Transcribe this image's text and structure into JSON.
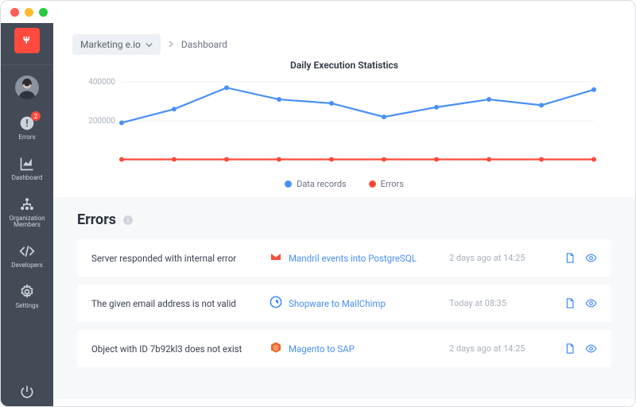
{
  "breadcrumb": {
    "project": "Marketing e.io",
    "current": "Dashboard"
  },
  "sidebar": {
    "errors_badge": "2",
    "items": [
      {
        "label": "Errors"
      },
      {
        "label": "Dashboard"
      },
      {
        "label": "Organization Members"
      },
      {
        "label": "Developers"
      },
      {
        "label": "Settings"
      }
    ]
  },
  "chart_data": {
    "type": "line",
    "title": "Daily Execution Statistics",
    "ylabel": "",
    "ylim": [
      0,
      400000
    ],
    "yticks": [
      200000,
      400000
    ],
    "ytick_labels": [
      "200000",
      "400000"
    ],
    "x": [
      0,
      1,
      2,
      3,
      4,
      5,
      6,
      7,
      8,
      9
    ],
    "series": [
      {
        "name": "Data records",
        "color": "#4a90f7",
        "values": [
          190000,
          260000,
          370000,
          310000,
          290000,
          220000,
          270000,
          310000,
          280000,
          360000
        ]
      },
      {
        "name": "Errors",
        "color": "#ff4a3d",
        "values": [
          2000,
          2000,
          2000,
          2000,
          2000,
          2000,
          2000,
          2000,
          2000,
          2000
        ]
      }
    ]
  },
  "errors": {
    "heading": "Errors",
    "rows": [
      {
        "message": "Server responded with internal error",
        "source": "Mandril events into PostgreSQL",
        "icon": "mandrill",
        "icon_color": "#ff4a3d",
        "time": "2 days ago at 14:25"
      },
      {
        "message": "The given email address is not valid",
        "source": "Shopware to MailChimp",
        "icon": "shopware",
        "icon_color": "#4a90f7",
        "time": "Today at 08:35"
      },
      {
        "message": "Object with ID 7b92kl3 does not exist",
        "source": "Magento to SAP",
        "icon": "magento",
        "icon_color": "#f26322",
        "time": "2 days ago at 14:25"
      }
    ]
  }
}
